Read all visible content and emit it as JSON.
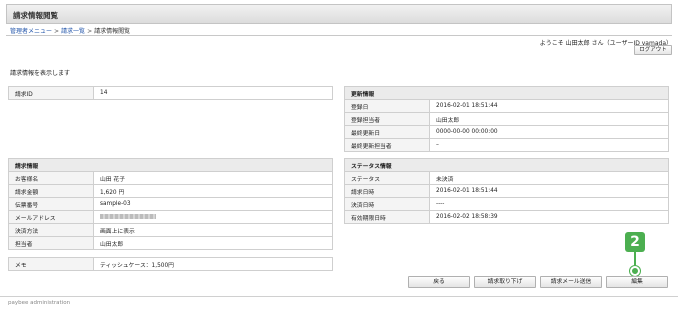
{
  "header": {
    "title": "請求情報閲覧"
  },
  "breadcrumb": {
    "items": [
      "管理者メニュー",
      "請求一覧",
      "請求情報閲覧"
    ],
    "separator": ">"
  },
  "user": {
    "welcome": "ようこそ 山田太郎 さん（ユーザーID yamada）",
    "logout_label": "ログアウト"
  },
  "intro_text": "請求情報を表示します",
  "invoice_id": {
    "label": "請求ID",
    "value": "14"
  },
  "update_info": {
    "heading": "更新情報",
    "rows": [
      {
        "label": "登録日",
        "value": "2016-02-01 18:51:44"
      },
      {
        "label": "登録担当者",
        "value": "山田太郎"
      },
      {
        "label": "最終更新日",
        "value": "0000-00-00 00:00:00"
      },
      {
        "label": "最終更新担当者",
        "value": "–"
      }
    ]
  },
  "invoice_info": {
    "heading": "請求情報",
    "rows": [
      {
        "label": "お客様名",
        "value": "山田 花子"
      },
      {
        "label": "請求金額",
        "value": "1,620 円"
      },
      {
        "label": "伝票番号",
        "value": "sample-03"
      },
      {
        "label": "メールアドレス",
        "value": ""
      },
      {
        "label": "決済方法",
        "value": "画面上に表示"
      },
      {
        "label": "担当者",
        "value": "山田太郎"
      }
    ]
  },
  "memo": {
    "label": "メモ",
    "value": "ティッシュケース：1,500円"
  },
  "status_info": {
    "heading": "ステータス情報",
    "rows": [
      {
        "label": "ステータス",
        "value": "未決済"
      },
      {
        "label": "請求日時",
        "value": "2016-02-01 18:51:44"
      },
      {
        "label": "決済日時",
        "value": "----"
      },
      {
        "label": "有効期限日時",
        "value": "2016-02-02 18:58:39"
      }
    ]
  },
  "buttons": {
    "back": "戻る",
    "cancel_invoice": "請求取り下げ",
    "send_email": "請求メール送信",
    "edit": "編集"
  },
  "step_marker": {
    "number": "2"
  },
  "footer": {
    "text": "paybee administration"
  },
  "colors": {
    "link": "#2255aa",
    "marker": "#4caf50",
    "header_bg": "#ebebeb"
  }
}
